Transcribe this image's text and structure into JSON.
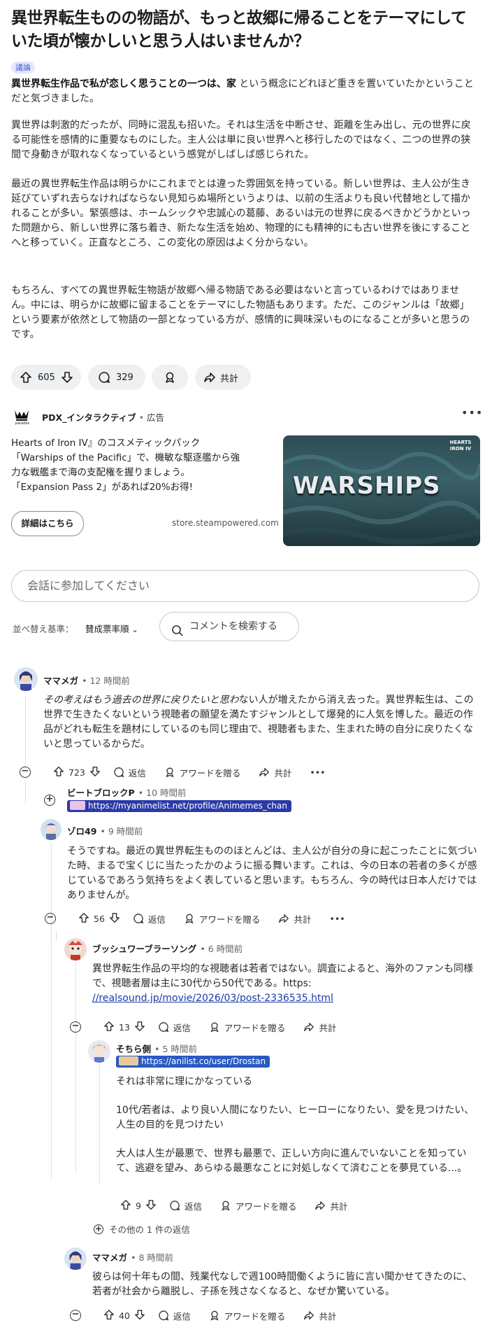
{
  "post": {
    "title": "異世界転生ものの物語が、もっと故郷に帰ることをテーマにしていた頃が懐かしいと思う人はいませんか？",
    "flair": "議論",
    "p1_bold": "異世界転生作品で私が恋しく思うことの一つは、家",
    "p1_rest": " という概念にどれほど重きを置いていたかということだと気づきました。",
    "p2": "異世界は刺激的だったが、同時に混乱も招いた。それは生活を中断させ、距離を生み出し、元の世界に戻る可能性を感情的に重要なものにした。主人公は単に良い世界へと移行したのではなく、二つの世界の狭間で身動きが取れなくなっているという感覚がしばしば感じられた。",
    "p3": "最近の異世界転生作品は明らかにこれまでとは違った雰囲気を持っている。新しい世界は、主人公が生き延びていずれ去らなければならない見知らぬ場所というよりは、以前の生活よりも良い代替地として描かれることが多い。緊張感は、ホームシックや忠誠心の葛藤、あるいは元の世界に戻るべきかどうかといった問題から、新しい世界に落ち着き、新たな生活を始め、物理的にも精神的にも古い世界を後にすることへと移っていく。正直なところ、この変化の原因はよく分からない。",
    "p4": "もちろん、すべての異世界転生物語が故郷へ帰る物語である必要はないと言っているわけではありません。中には、明らかに故郷に留まることをテーマにした物語もあります。ただ、このジャンルは「故郷」という要素が依然として物語の一部となっている方が、感情的に興味深いものになることが多いと思うのです。",
    "votes": "605",
    "comments": "329",
    "share": "共計"
  },
  "ad": {
    "advertiser": "PDX_インタラクティブ",
    "label": "広告",
    "line1": "Hearts of Iron IV』のコスメティックパック",
    "line2": "「Warships of the Pacific」で、機敏な駆逐艦から強",
    "line3": "力な戦艦まで海の支配権を握りましょう。",
    "line4": "「Expansion Pass 2」があれば20%お得!",
    "button": "詳細はこちら",
    "url": "store.steampowered.com",
    "image_text": "WARSHIPS",
    "image_badge": "HEARTS IRON IV",
    "logo_text": "paradox"
  },
  "join": {
    "placeholder": "会話に参加してください"
  },
  "sort": {
    "label": "並べ替え基準：",
    "value": "賛成票率順"
  },
  "search": {
    "placeholder": "コメントを検索する"
  },
  "labels": {
    "reply": "返信",
    "award": "アワードを贈る",
    "share": "共計"
  },
  "comments": [
    {
      "user": "ママメガ",
      "time": "12 時間前",
      "text_em": "その考えはもう過去の世界に戻りたいと思わ",
      "text_rest": "ない人が増えたから消え去った。異世界転生は、この世界で生きたくないという視聴者の願望を満たすジャンルとして爆発的に人気を博した。最近の作品がどれも転生を題材にしているのも同じ理由で、視聴者もまた、生まれた時の自分に戻りたくないと思っているからだ。",
      "votes": "723"
    },
    {
      "user": "ビートブロックP",
      "time": "10 時間前",
      "flair": "https://myanimelist.net/profile/Animemes_chan"
    },
    {
      "user": "ゾロ49",
      "time": "9 時間前",
      "text": "そうですね。最近の異世界転生もののほとんどは、主人公が自分の身に起こったことに気づいた時、まるで宝くじに当たったかのように振る舞います。これは、今の日本の若者の多くが感じているであろう気持ちをよく表していると思います。もちろん、今の時代は日本人だけではありませんが。",
      "votes": "56"
    },
    {
      "user": "ブッシュワーブラーソング",
      "time": "6 時間前",
      "text": "異世界転生作品の平均的な視聴者は若者ではない。調査によると、海外のファンも同様で、視聴者層は主に30代から50代である。https:",
      "link": "//realsound.jp/movie/2026/03/post-2336535.html",
      "votes": "13"
    },
    {
      "user": "そちら側",
      "time": "5 時間前",
      "flair": "https://anilist.co/user/Drostan",
      "t1": "それは非常に理にかなっている",
      "t2": "10代/若者は、より良い人間になりたい、ヒーローになりたい、愛を見つけたい、人生の目的を見つけたい",
      "t3": "大人は人生が最悪で、世界も最悪で、正しい方向に進んでいないことを知っていて、逃避を望み、あらゆる最悪なことに対処しなくて済むことを夢見ている...。",
      "votes": "9"
    },
    {
      "more": "その他の 1 件の返信"
    },
    {
      "user": "ママメガ",
      "time": "8 時間前",
      "text": "彼らは何十年もの間、残業代なしで週100時間働くように皆に言い聞かせてきたのに、若者が社会から離脱し、子孫を残さなくなると、なぜか驚いている。",
      "votes": "40"
    }
  ],
  "colors": {
    "accent": "#3b5bdb",
    "pill": "#eef0f2",
    "flair_blue": "#2b59c3"
  }
}
